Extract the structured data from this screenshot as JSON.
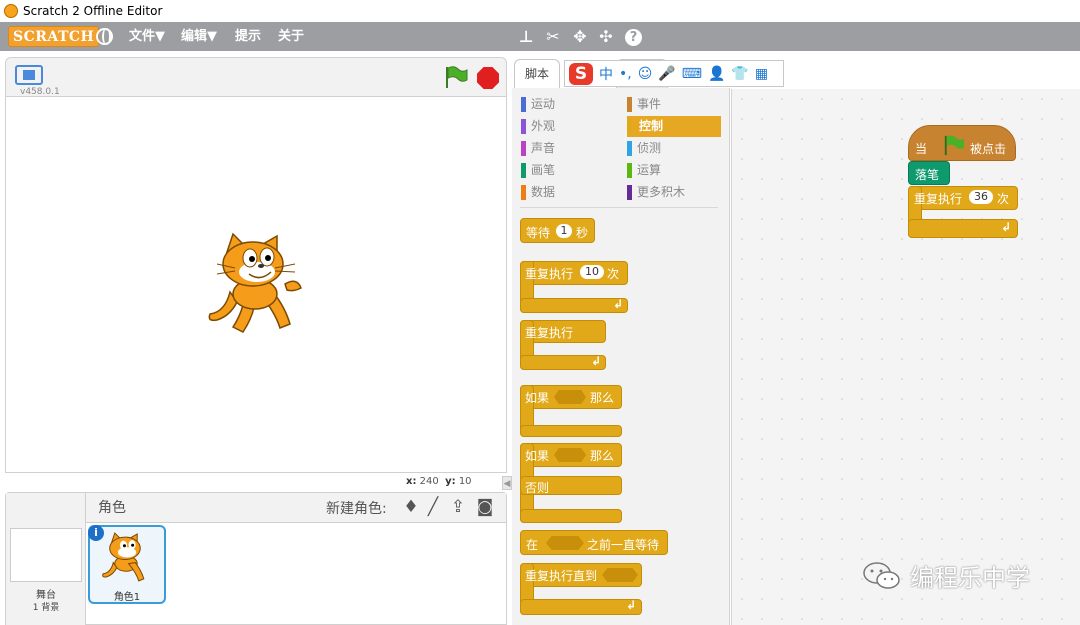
{
  "window": {
    "title": "Scratch 2 Offline Editor"
  },
  "menubar": {
    "logo": "SCRATCH",
    "items": [
      "文件▼",
      "编辑▼",
      "提示",
      "关于"
    ]
  },
  "stage": {
    "version": "v458.0.1",
    "coords": {
      "x_label": "x:",
      "x": "240",
      "y_label": "y:",
      "y": "10"
    }
  },
  "sprites": {
    "title": "角色",
    "new_sprite_label": "新建角色:",
    "stage_label": "舞台",
    "stage_backdrops": "1 背景",
    "items": [
      {
        "name": "角色1"
      }
    ]
  },
  "tabs": {
    "scripts": "脚本"
  },
  "ime": {
    "logo": "S",
    "mode": "中",
    "punct": "•,",
    "emoji": "☺",
    "mic": "🎤",
    "kbd": "⌨",
    "user": "👤",
    "shirt": "👕",
    "grid": "▦"
  },
  "categories": [
    {
      "label": "运动",
      "color": "#4a6cd4"
    },
    {
      "label": "事件",
      "color": "#c88330"
    },
    {
      "label": "外观",
      "color": "#8a55d7"
    },
    {
      "label": "控制",
      "color": "#e1a91a",
      "selected": true
    },
    {
      "label": "声音",
      "color": "#bb42c3"
    },
    {
      "label": "侦测",
      "color": "#2ca5e2"
    },
    {
      "label": "画笔",
      "color": "#0e9a6c"
    },
    {
      "label": "运算",
      "color": "#5cb712"
    },
    {
      "label": "数据",
      "color": "#ee7d16"
    },
    {
      "label": "更多积木",
      "color": "#632d99"
    }
  ],
  "palette_blocks": {
    "wait": {
      "pre": "等待",
      "value": "1",
      "post": "秒"
    },
    "repeat": {
      "pre": "重复执行",
      "value": "10",
      "post": "次"
    },
    "forever": {
      "label": "重复执行"
    },
    "if_then": {
      "pre": "如果",
      "post": "那么"
    },
    "if_else": {
      "pre": "如果",
      "post": "那么",
      "else": "否则"
    },
    "wait_until": {
      "pre": "在",
      "post": "之前一直等待"
    },
    "repeat_until": {
      "label": "重复执行直到"
    }
  },
  "script": {
    "hat": {
      "pre": "当",
      "post": "被点击"
    },
    "pen_down": "落笔",
    "repeat": {
      "pre": "重复执行",
      "value": "36",
      "post": "次"
    }
  },
  "watermark": "编程乐中学",
  "colors": {
    "control": "#e1a91a",
    "pen": "#0e9a6c",
    "event": "#c88330",
    "menubar": "#9c9ea2"
  }
}
